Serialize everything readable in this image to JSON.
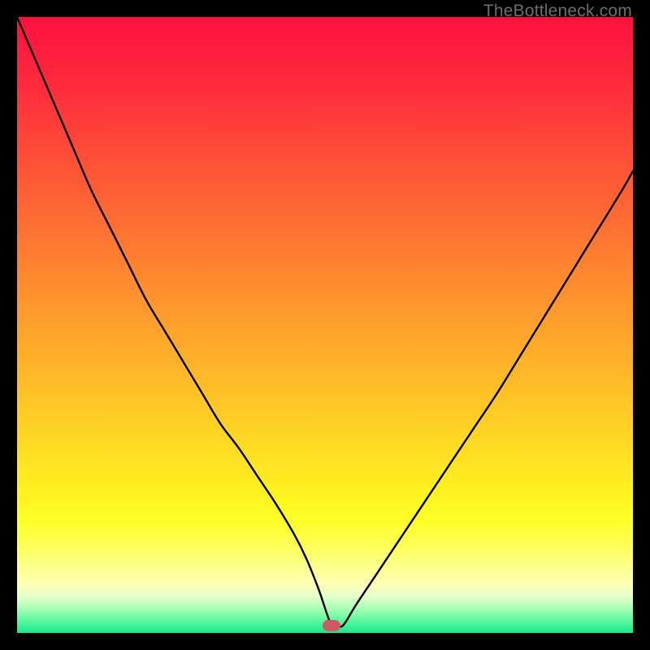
{
  "watermark": "TheBottleneck.com",
  "chart_data": {
    "type": "line",
    "title": "",
    "xlabel": "",
    "ylabel": "",
    "xlim": [
      0,
      100
    ],
    "ylim": [
      0,
      100
    ],
    "marker": {
      "x": 51,
      "y": 1.2
    },
    "series": [
      {
        "name": "bottleneck-curve",
        "x": [
          0,
          3,
          6,
          9,
          12,
          15,
          18,
          21,
          24,
          27,
          30,
          33,
          36,
          39,
          42,
          45,
          47,
          49,
          51,
          52,
          53,
          55,
          58,
          62,
          66,
          70,
          74,
          78,
          82,
          86,
          90,
          94,
          98,
          100
        ],
        "y": [
          100,
          93,
          86,
          79,
          72,
          66,
          60,
          54,
          49,
          44,
          39,
          34,
          30,
          25.5,
          21,
          16,
          12,
          7,
          1.3,
          1.2,
          1.3,
          4.5,
          9,
          15,
          21,
          27,
          33,
          39,
          45.5,
          52,
          58.5,
          65,
          71.5,
          75
        ]
      }
    ],
    "gradient_stops": [
      {
        "pos": 0,
        "color": "#ff113e"
      },
      {
        "pos": 40,
        "color": "#ff7a31"
      },
      {
        "pos": 78,
        "color": "#fff41f"
      },
      {
        "pos": 92,
        "color": "#fdffb4"
      },
      {
        "pos": 100,
        "color": "#18e98c"
      }
    ]
  }
}
